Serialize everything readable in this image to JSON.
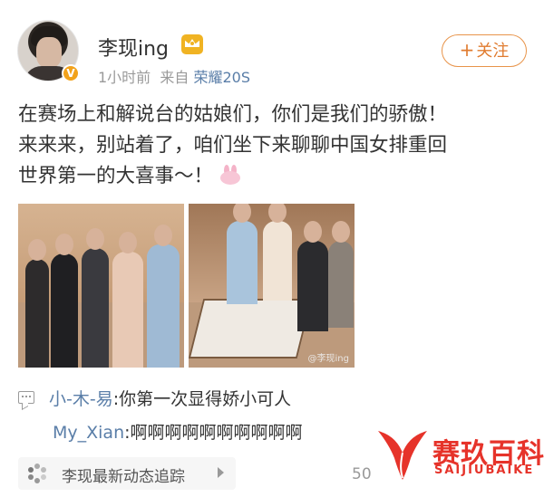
{
  "post": {
    "author": "李现ing",
    "time": "1小时前",
    "source_prefix": "来自",
    "device": "荣耀20S",
    "follow_label": "关注",
    "follow_plus": "+",
    "content_lines": [
      "在赛场上和解说台的姑娘们，你们是我们的骄傲！",
      "来来来，别站着了，咱们坐下来聊聊中国女排重回",
      "世界第一的大喜事～！"
    ],
    "photo_watermark": "@李现ing"
  },
  "comments": [
    {
      "user": "小-木-易",
      "text": "你第一次显得娇小可人"
    },
    {
      "user": "My_Xian",
      "text": "啊啊啊啊啊啊啊啊啊啊"
    }
  ],
  "footer": {
    "topic": "李现最新动态追踪",
    "count": "50"
  },
  "watermark": {
    "name_cn": "赛玖百科",
    "name_en": "SAIJIUBAIKE"
  },
  "colors": {
    "link": "#5a7ea8",
    "follow": "#e07b2f",
    "logo": "#e6332a"
  }
}
